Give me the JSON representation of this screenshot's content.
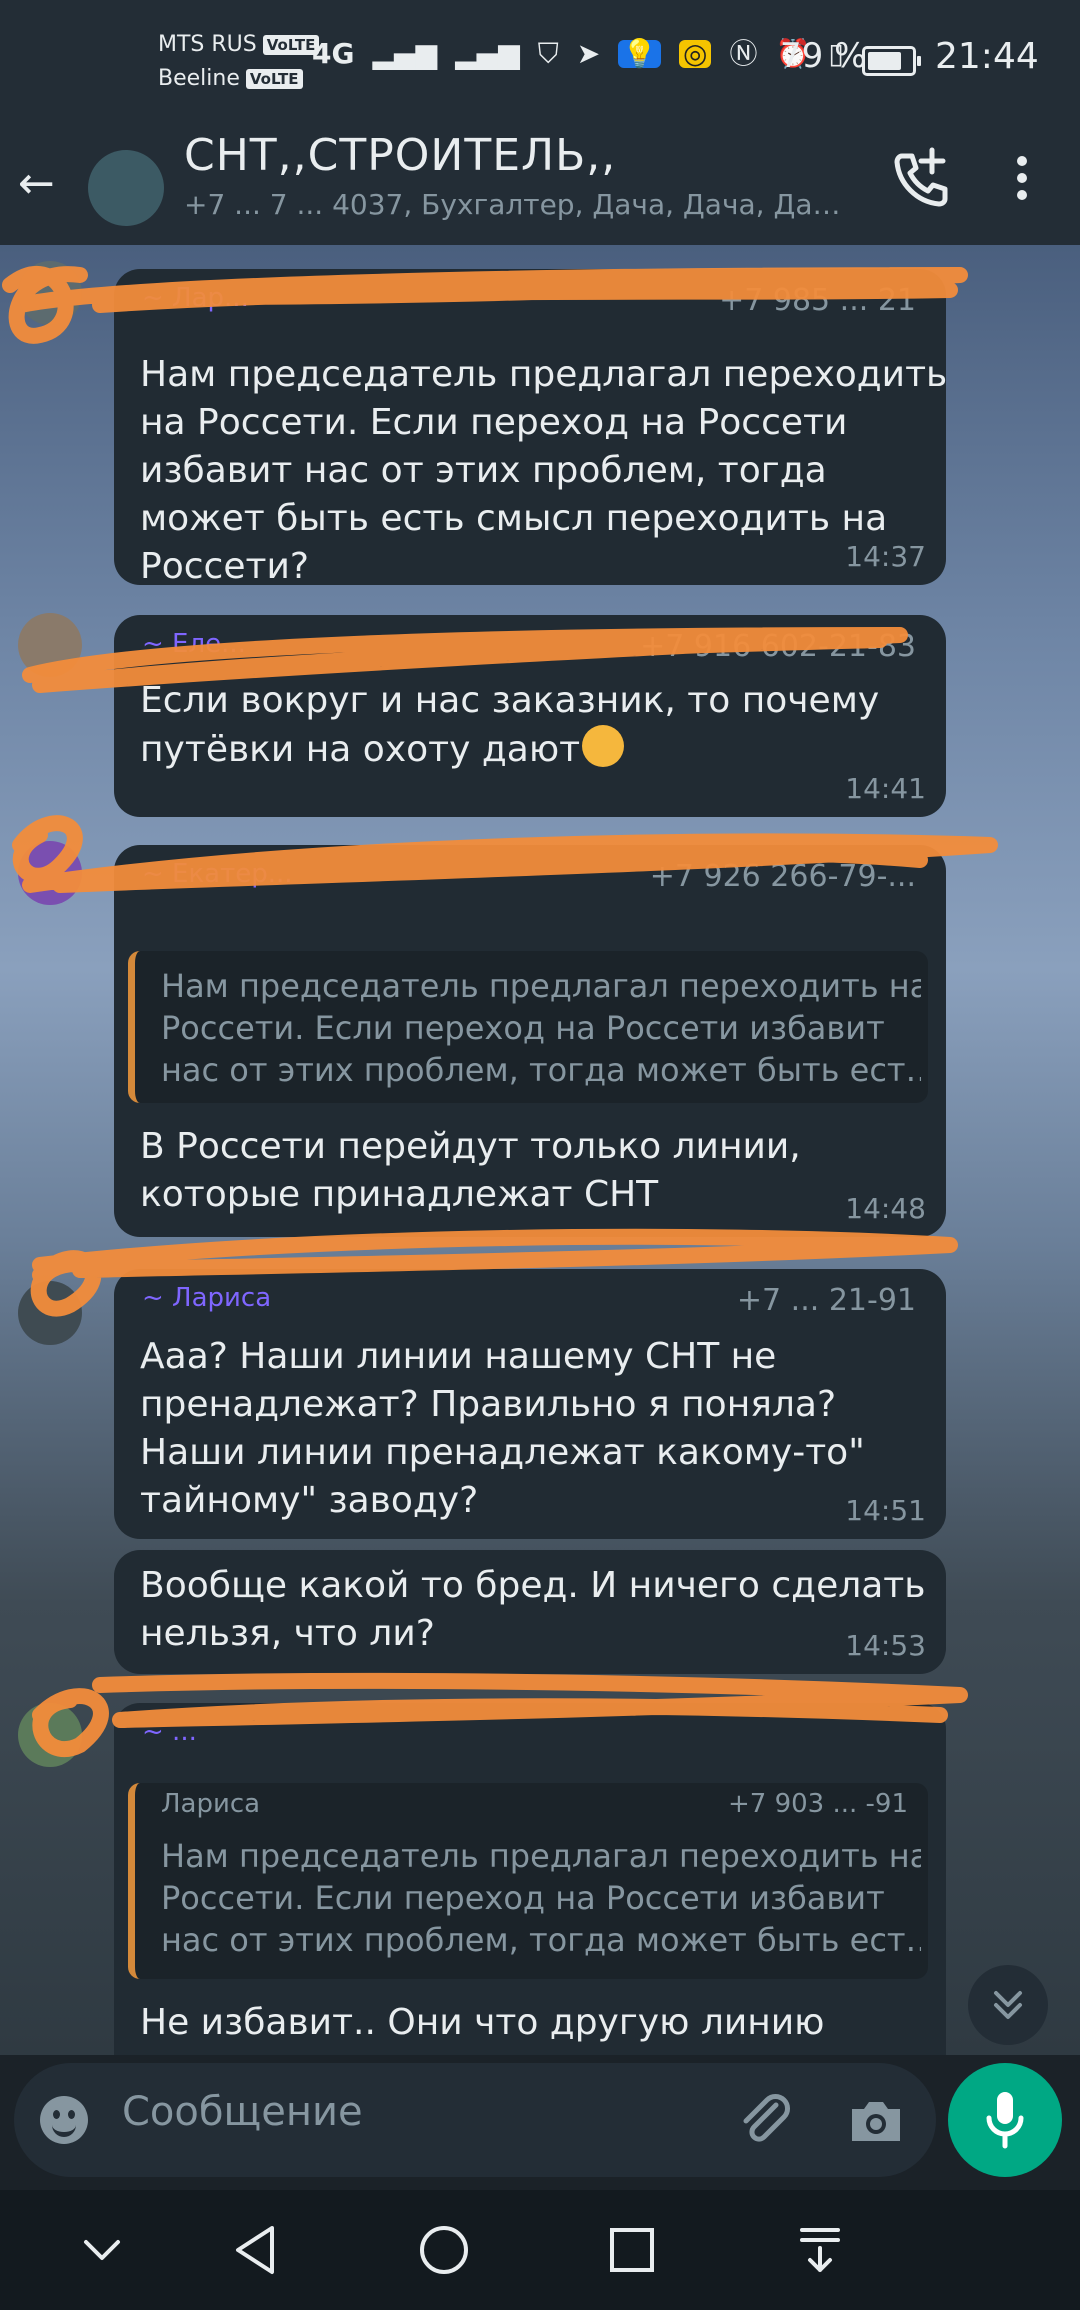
{
  "status_bar": {
    "operator1": "MTS RUS",
    "operator2": "Beeline",
    "volte": "VoLTE",
    "network": "4G",
    "battery": "79 %",
    "time": "21:44"
  },
  "header": {
    "title": "СНТ,,СТРОИТЕЛЬ,,",
    "subtitle": "+7 ... 7 ... 4037, Бухгалтер, Дача, Дача, Да…"
  },
  "messages": [
    {
      "sender": "~ Лар...",
      "phone": "+7 985 ... 21",
      "text": "Нам председатель предлагал переходить\nна Россети. Если переход на Россети\nизбавит нас от этих проблем, тогда\nможет быть есть смысл переходить на\nРоссети?",
      "time": "14:37"
    },
    {
      "sender": "~ Еле...",
      "phone": "+7 916 602-21-83",
      "text": "Если вокруг и нас заказник, то почему\nпутёвки на охоту дают",
      "emoji": "thinking-face",
      "time": "14:41"
    },
    {
      "sender": "~ Екатер...",
      "phone": "+7 926 266-79-...",
      "quote": "Нам председатель предлагал переходить на\nРоссети. Если переход на Россети избавит\nнас от этих проблем, тогда может быть ест…",
      "text": "В Россети перейдут только линии,\nкоторые принадлежат СНТ",
      "time": "14:48"
    },
    {
      "sender": "~ Лариса",
      "phone": "+7 ... 21-91",
      "text": "Ааа? Наши линии нашему СНТ не\nпренадлежат? Правильно я поняла?\nНаши линии пренадлежат какому-то\"\nтайному\" заводу?",
      "time": "14:51"
    },
    {
      "text": "Вообще какой то бред. И ничего сделать\nнельзя, что ли?",
      "time": "14:53"
    },
    {
      "sender": "~ ...",
      "quote_name": "Лариса",
      "quote_phone": "+7 903 ... -91",
      "quote": "Нам председатель предлагал переходить на\nРоссети. Если переход на Россети избавит\nнас от этих проблем, тогда может быть ест…",
      "text": "Не избавит.. Они что другую линию\nпотянут?"
    }
  ],
  "input": {
    "placeholder": "Сообщение"
  },
  "icons": {
    "call": "add-call-icon",
    "menu": "more-vert-icon",
    "attach": "paperclip-icon",
    "camera": "camera-icon",
    "mic": "mic-icon",
    "scroll": "double-chevron-down-icon"
  },
  "colors": {
    "bubble": "#212b33",
    "accent": "#00a884",
    "redaction": "#f28c3b"
  }
}
